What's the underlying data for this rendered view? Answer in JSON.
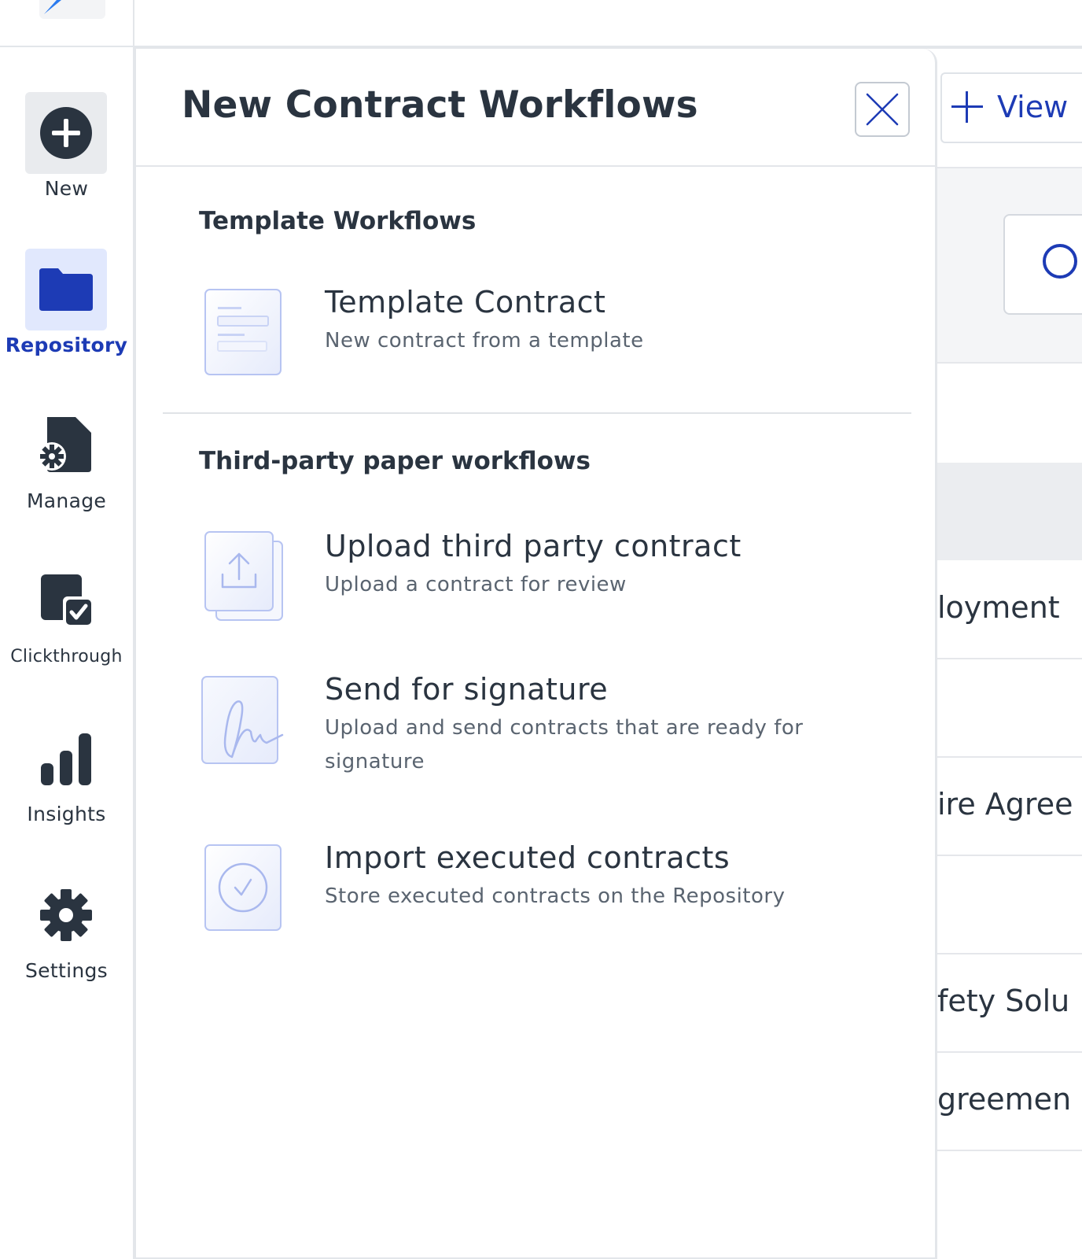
{
  "sidebar": {
    "items": [
      {
        "label": "New",
        "icon": "plus-circle-icon",
        "active": false
      },
      {
        "label": "Repository",
        "icon": "folder-icon",
        "active": true
      },
      {
        "label": "Manage",
        "icon": "document-gear-icon",
        "active": false
      },
      {
        "label": "Clickthrough",
        "icon": "document-check-icon",
        "active": false
      },
      {
        "label": "Insights",
        "icon": "bar-chart-icon",
        "active": false
      },
      {
        "label": "Settings",
        "icon": "gear-icon",
        "active": false
      }
    ]
  },
  "panel": {
    "title": "New Contract Workflows",
    "close_icon": "close-icon",
    "sections": [
      {
        "title": "Template Workflows",
        "items": [
          {
            "title": "Template Contract",
            "description": "New contract from a template",
            "icon": "template-document-icon"
          }
        ]
      },
      {
        "title": "Third-party paper workflows",
        "items": [
          {
            "title": "Upload third party contract",
            "description": "Upload a contract for review",
            "icon": "upload-document-icon"
          },
          {
            "title": "Send for signature",
            "description": "Upload and send contracts that are ready for signature",
            "icon": "signature-icon"
          },
          {
            "title": "Import executed contracts",
            "description": "Store executed contracts on the Repository",
            "icon": "check-document-icon"
          }
        ]
      }
    ]
  },
  "background": {
    "view_button_label": "View",
    "rows": [
      "loyment",
      "",
      "ire Agree",
      "",
      "fety Solu",
      "greemen"
    ]
  },
  "colors": {
    "accent": "#1d3bb5",
    "active_bg": "#e1e8fd",
    "icon_tint": "#b7c4f2",
    "text": "#2a3440",
    "muted": "#5a6470"
  }
}
